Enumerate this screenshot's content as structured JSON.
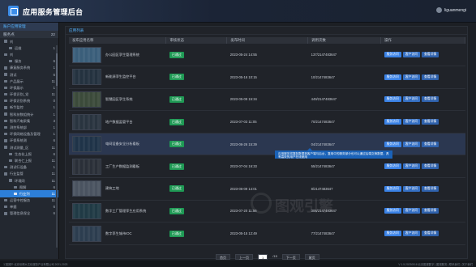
{
  "app": {
    "title": "应用服务管理后台",
    "user": "liguanmengi"
  },
  "sidebar": {
    "heading": "账户应用管理",
    "stat": {
      "label": "服务点",
      "value": "22"
    },
    "items": [
      {
        "label": "刘",
        "count": "",
        "level": 1
      },
      {
        "label": "运维",
        "count": "1",
        "level": 2
      },
      {
        "label": "刘",
        "count": "",
        "level": 1
      },
      {
        "label": "服务",
        "count": "6",
        "level": 2
      },
      {
        "label": "康复服务系统",
        "count": "1",
        "level": 1
      },
      {
        "label": "测试",
        "count": "6",
        "level": 1
      },
      {
        "label": "产品展示",
        "count": "11",
        "level": 1
      },
      {
        "label": "环保展示",
        "count": "1",
        "level": 1
      },
      {
        "label": "环保识别_党",
        "count": "11",
        "level": 1
      },
      {
        "label": "环保识别系统",
        "count": "0",
        "level": 1
      },
      {
        "label": "新华监控",
        "count": "1",
        "level": 1
      },
      {
        "label": "智科技数组统计",
        "count": "1",
        "level": 1
      },
      {
        "label": "智科汽电采集",
        "count": "3",
        "level": 1
      },
      {
        "label": "测控系统部",
        "count": "1",
        "level": 1
      },
      {
        "label": "环保网络设备及管理",
        "count": "1",
        "level": 1
      },
      {
        "label": "环保系统测",
        "count": "6",
        "level": 1
      },
      {
        "label": "测试测量_区",
        "count": "11",
        "level": 1
      },
      {
        "label": "生态化上报",
        "count": "6",
        "level": 2
      },
      {
        "label": "联合仁上报",
        "count": "11",
        "level": 2
      },
      {
        "label": "测试行设备",
        "count": "1",
        "level": 1
      },
      {
        "label": "行业监管",
        "count": "11",
        "level": 1
      },
      {
        "label": "环境网",
        "count": "11",
        "level": 2
      },
      {
        "label": "图解",
        "count": "6",
        "level": 3
      },
      {
        "label": "行业列",
        "count": "11",
        "level": 3,
        "active": true
      },
      {
        "label": "运营中控服务",
        "count": "11",
        "level": 1
      },
      {
        "label": "单据",
        "count": "6",
        "level": 1
      },
      {
        "label": "管理信息保全",
        "count": "6",
        "level": 1
      }
    ]
  },
  "main": {
    "heading": "应用列表",
    "columns": [
      "发布应用名称",
      "审核状态",
      "发布时间",
      "调用次数",
      "操作"
    ],
    "rows": [
      {
        "name": "办公园区孪生管理系统",
        "status": "已通过",
        "time": "2023-05-24 14:55",
        "calls": "137/2147483647"
      },
      {
        "name": "新能源孪生监控平台",
        "status": "已通过",
        "time": "2023-05-16 10:15",
        "calls": "10/2147483647"
      },
      {
        "name": "智慧园区孪生系统",
        "status": "已通过",
        "time": "2023-05-09 15:34",
        "calls": "449/2147483647"
      },
      {
        "name": "地产数据监管平台",
        "status": "已通过",
        "time": "2023-07-03 11:05",
        "calls": "70/2147483647"
      },
      {
        "name": "电网设备安全分析看板",
        "status": "已通过",
        "time": "2023-06-26 15:39",
        "calls": "04/2147483647",
        "highlight": true
      },
      {
        "name": "工厂生产数据监测看板",
        "status": "已通过",
        "time": "2023-07-04 16:33",
        "calls": "55/2147483647"
      },
      {
        "name": "建筑工地",
        "status": "已通过",
        "time": "2023-06-09 14:01",
        "calls": "8/2147483647"
      },
      {
        "name": "数字工厂管理孪生应用系统",
        "status": "已通过",
        "time": "2023-07-20 11:56",
        "calls": "306/2147483647"
      },
      {
        "name": "数字孪生城市IOC",
        "status": "已通过",
        "time": "2023-05-15 12:49",
        "calls": "77/2147483647"
      }
    ],
    "ops": [
      "服务访问",
      "客户访问",
      "查看详情"
    ],
    "tooltip": "应用服务将复制数据到客户端与后台，复用中的服务部分也可以通过后端交换数据，具有高效的用户在线使用",
    "pager": {
      "first": "首页",
      "prev": "上一页",
      "page": "1",
      "total": "/15",
      "next": "下一页",
      "last": "尾页"
    },
    "watermark": "图观引擎"
  },
  "footer": {
    "left": "ⓒ图观® 北京世博大文化服务产业有限公司 2021-2023",
    "right": "V 1.5.20230518 北京图观数字 | 图观服务 | 联系我们 | 关于我们"
  },
  "colors": {
    "accent": "#2d7fd8",
    "status": "#1f9a55",
    "background": "#1c1f24"
  }
}
